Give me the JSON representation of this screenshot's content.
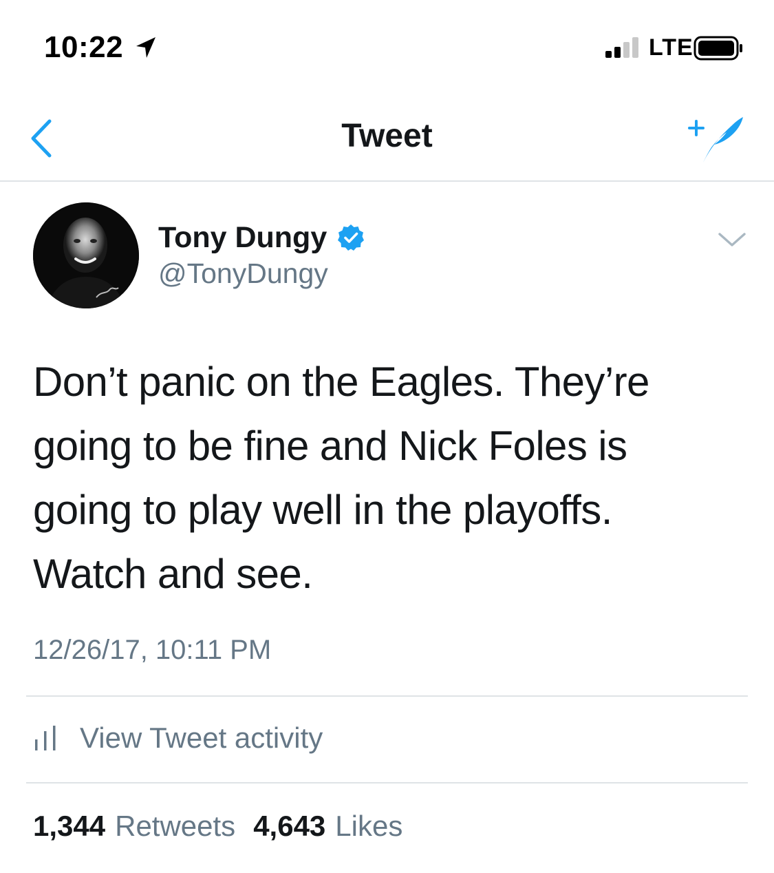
{
  "status_bar": {
    "time": "10:22",
    "network": "LTE",
    "icons": [
      "location-arrow-icon",
      "signal-icon",
      "battery-icon"
    ]
  },
  "nav": {
    "title": "Tweet",
    "back_icon": "chevron-left-icon",
    "compose_icon": "compose-tweet-icon"
  },
  "tweet": {
    "author": {
      "display_name": "Tony Dungy",
      "handle": "@TonyDungy",
      "verified": true
    },
    "text_lines": [
      "Don’t panic on the Eagles. They’re",
      "going to be fine and Nick Foles is",
      "going to play well in the playoffs.",
      "Watch and see."
    ],
    "timestamp": "12/26/17, 10:11 PM",
    "activity_label": "View Tweet activity",
    "stats": {
      "retweets_count": "1,344",
      "retweets_label": "Retweets",
      "likes_count": "4,643",
      "likes_label": "Likes"
    }
  },
  "colors": {
    "twitter_blue": "#1da1f2",
    "text_primary": "#14171a",
    "text_secondary": "#657786",
    "divider": "#dfe3e6"
  }
}
